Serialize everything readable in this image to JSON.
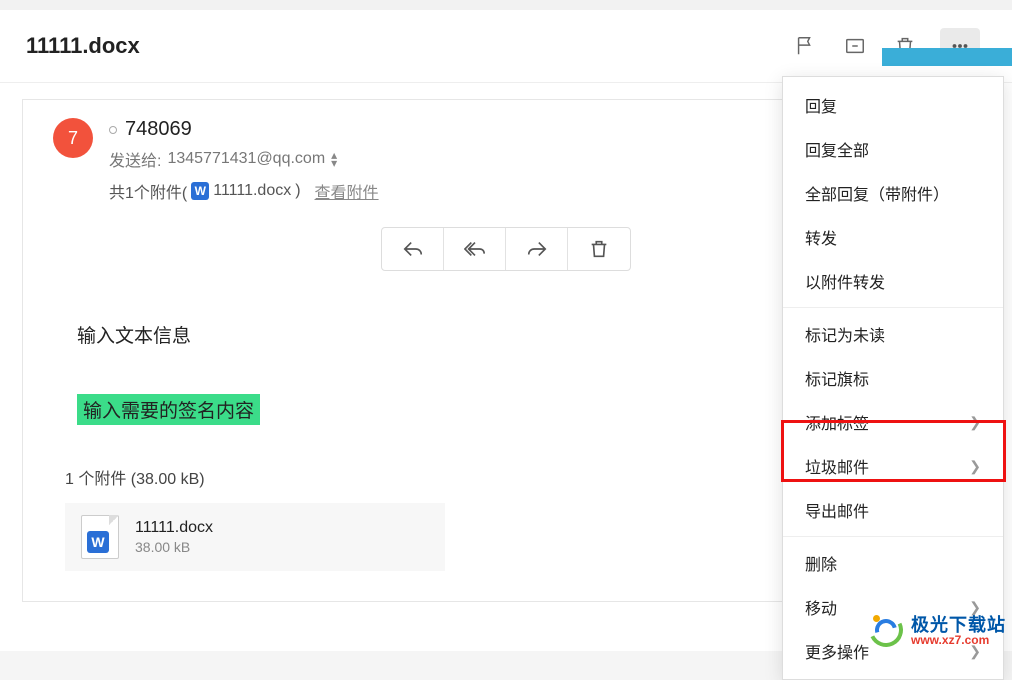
{
  "header": {
    "title": "11111.docx"
  },
  "avatar_text": "7",
  "sender": "748069",
  "to_label": "发送给:",
  "to_addr": "1345771431@qq.com",
  "attach_summary_prefix": "共1个附件(",
  "attach_summary_name": "11111.docx",
  "attach_summary_suffix": ")",
  "view_attach": "查看附件",
  "body": {
    "line1": "输入文本信息",
    "line2": "输入需要的签名内容"
  },
  "attach_section_label": "1 个附件 (38.00 kB)",
  "attachment": {
    "name": "11111.docx",
    "size": "38.00 kB"
  },
  "menu": {
    "reply": "回复",
    "reply_all": "回复全部",
    "reply_all_attach": "全部回复（带附件）",
    "forward": "转发",
    "forward_as_attach": "以附件转发",
    "mark_unread": "标记为未读",
    "mark_flag": "标记旗标",
    "add_tag": "添加标签",
    "junk": "垃圾邮件",
    "export": "导出邮件",
    "delete": "删除",
    "move": "移动",
    "more": "更多操作"
  },
  "watermark": {
    "cn": "极光下载站",
    "en": "www.xz7.com"
  }
}
